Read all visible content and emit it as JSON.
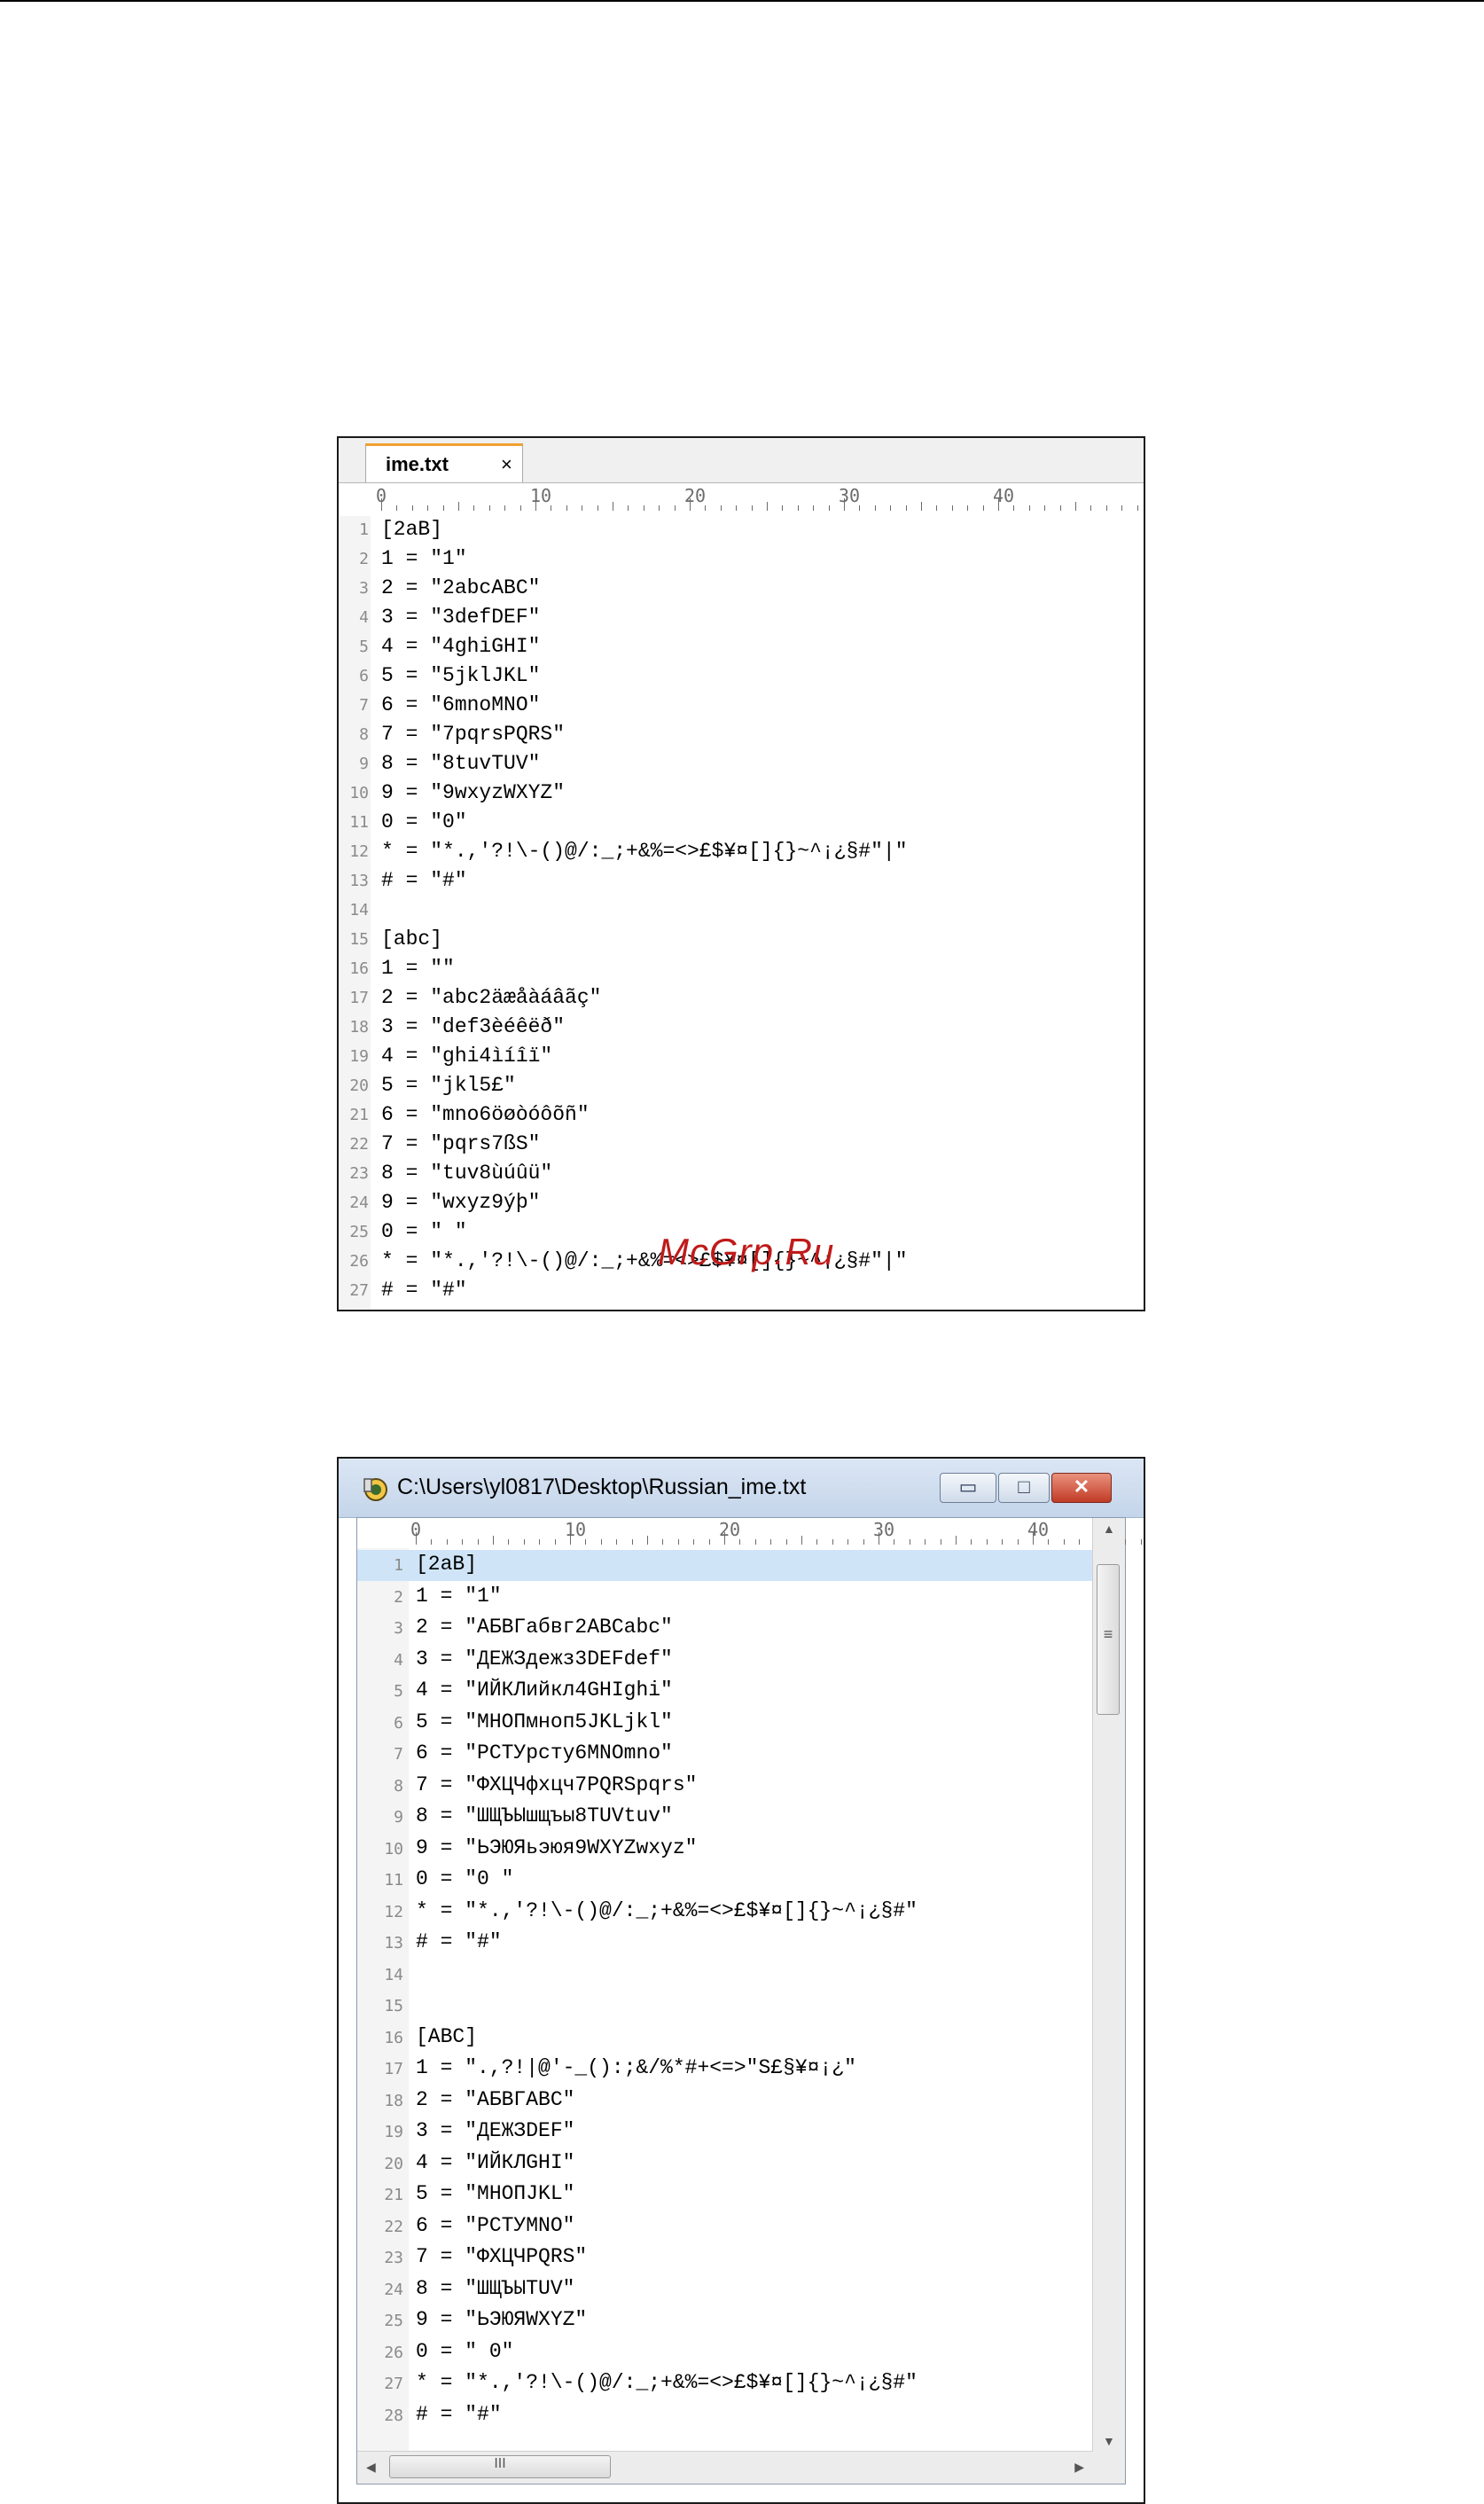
{
  "editor1": {
    "tab_label": "ime.txt",
    "tab_close": "×",
    "ruler_labels": [
      "0",
      "10",
      "20",
      "30",
      "40"
    ],
    "lines": [
      {
        "num": "1",
        "text": "[2aB]"
      },
      {
        "num": "2",
        "text": "1 = \"1\""
      },
      {
        "num": "3",
        "text": "2 = \"2abcABC\""
      },
      {
        "num": "4",
        "text": "3 = \"3defDEF\""
      },
      {
        "num": "5",
        "text": "4 = \"4ghiGHI\""
      },
      {
        "num": "6",
        "text": "5 = \"5jklJKL\""
      },
      {
        "num": "7",
        "text": "6 = \"6mnoMNO\""
      },
      {
        "num": "8",
        "text": "7 = \"7pqrsPQRS\""
      },
      {
        "num": "9",
        "text": "8 = \"8tuvTUV\""
      },
      {
        "num": "10",
        "text": "9 = \"9wxyzWXYZ\""
      },
      {
        "num": "11",
        "text": "0 = \"0\""
      },
      {
        "num": "12",
        "text": "* = \"*.,'?!\\-()@/:_;+&%=<>£$¥¤[]{}~^¡¿§#\"|\""
      },
      {
        "num": "13",
        "text": "# = \"#\""
      },
      {
        "num": "14",
        "text": ""
      },
      {
        "num": "15",
        "text": "[abc]"
      },
      {
        "num": "16",
        "text": "1 = \"\""
      },
      {
        "num": "17",
        "text": "2 = \"abc2äæåàáâãç\""
      },
      {
        "num": "18",
        "text": "3 = \"def3èéêëð\""
      },
      {
        "num": "19",
        "text": "4 = \"ghi4ìíîï\""
      },
      {
        "num": "20",
        "text": "5 = \"jkl5£\""
      },
      {
        "num": "21",
        "text": "6 = \"mno6öøòóôõñ\""
      },
      {
        "num": "22",
        "text": "7 = \"pqrs7ßS\""
      },
      {
        "num": "23",
        "text": "8 = \"tuv8ùúûü\""
      },
      {
        "num": "24",
        "text": "9 = \"wxyz9ýþ\""
      },
      {
        "num": "25",
        "text": "0 = \" \""
      },
      {
        "num": "26",
        "text": "* = \"*.,'?!\\-()@/:_;+&%=<>£$¥¤[]{}~^¡¿§#\"|\""
      },
      {
        "num": "27",
        "text": "# = \"#\""
      }
    ]
  },
  "watermark": "McGrp.Ru",
  "editor2": {
    "window_title": "C:\\Users\\yl0817\\Desktop\\Russian_ime.txt",
    "minimize_glyph": "▭",
    "maximize_glyph": "□",
    "close_glyph": "✕",
    "ruler_labels": [
      "0",
      "10",
      "20",
      "30",
      "40"
    ],
    "scroll_grip": "≡",
    "hscroll_grip": "III",
    "lines": [
      {
        "num": "1",
        "text": "[2aB]"
      },
      {
        "num": "2",
        "text": "1 = \"1\""
      },
      {
        "num": "3",
        "text": "2 = \"АБВГабвг2ABCabc\""
      },
      {
        "num": "4",
        "text": "3 = \"ДЕЖЗдежз3DEFdef\""
      },
      {
        "num": "5",
        "text": "4 = \"ИЙКЛийкл4GHIghi\""
      },
      {
        "num": "6",
        "text": "5 = \"МНОПмноп5JKLjkl\""
      },
      {
        "num": "7",
        "text": "6 = \"РСТУрсту6MNOmno\""
      },
      {
        "num": "8",
        "text": "7 = \"ФХЦЧфхцч7PQRSpqrs\""
      },
      {
        "num": "9",
        "text": "8 = \"ШЩЪЫшщъы8TUVtuv\""
      },
      {
        "num": "10",
        "text": "9 = \"ЬЭЮЯьэюя9WXYZwxyz\""
      },
      {
        "num": "11",
        "text": "0 = \"0 \""
      },
      {
        "num": "12",
        "text": "* = \"*.,'?!\\-()@/:_;+&%=<>£$¥¤[]{}~^¡¿§#\""
      },
      {
        "num": "13",
        "text": "# = \"#\""
      },
      {
        "num": "14",
        "text": ""
      },
      {
        "num": "15",
        "text": ""
      },
      {
        "num": "16",
        "text": "[ABC]"
      },
      {
        "num": "17",
        "text": "1 = \".,?!|@'-_():;&/%*#+<=>\"S£§¥¤¡¿\""
      },
      {
        "num": "18",
        "text": "2 = \"АБВГABC\""
      },
      {
        "num": "19",
        "text": "3 = \"ДЕЖЗDEF\""
      },
      {
        "num": "20",
        "text": "4 = \"ИЙКЛGHI\""
      },
      {
        "num": "21",
        "text": "5 = \"МНОПJKL\""
      },
      {
        "num": "22",
        "text": "6 = \"РСТУMNO\""
      },
      {
        "num": "23",
        "text": "7 = \"ФХЦЧPQRS\""
      },
      {
        "num": "24",
        "text": "8 = \"ШЩЪЫTUV\""
      },
      {
        "num": "25",
        "text": "9 = \"ЬЭЮЯWXYZ\""
      },
      {
        "num": "26",
        "text": "0 = \" 0\""
      },
      {
        "num": "27",
        "text": "* = \"*.,'?!\\-()@/:_;+&%=<>£$¥¤[]{}~^¡¿§#\""
      },
      {
        "num": "28",
        "text": "# = \"#\""
      }
    ]
  }
}
